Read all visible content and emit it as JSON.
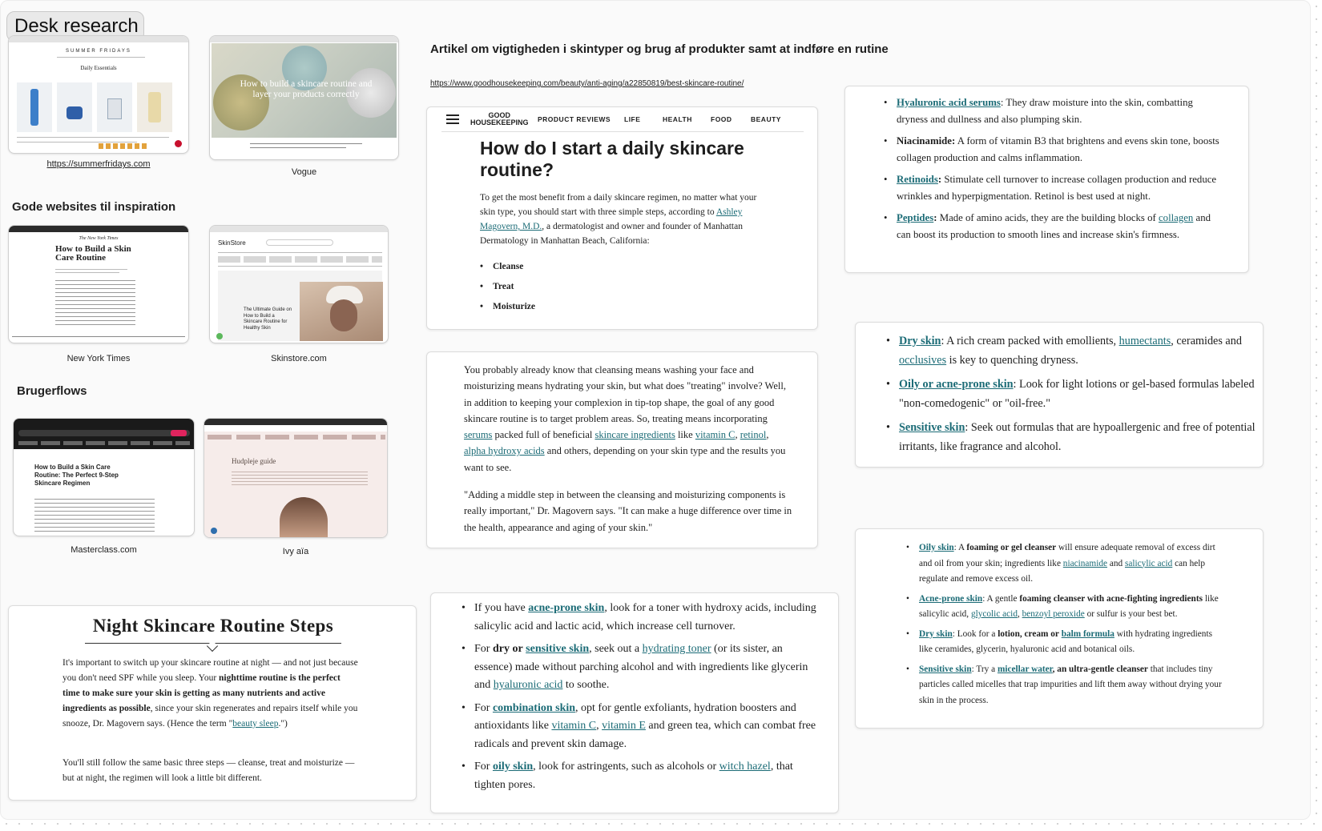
{
  "board": {
    "title": "Desk research",
    "section_inspiration": "Gode websites til inspiration",
    "section_userflows": "Brugerflows",
    "article_heading": "Artikel om vigtigheden i skintyper og brug af produkter samt at indføre en rutine",
    "article_url": "https://www.goodhousekeeping.com/beauty/anti-aging/a22850819/best-skincare-routine/"
  },
  "thumbnails": {
    "summerfridays": {
      "caption": "https://summerfridays.com",
      "brand": "SUMMER FRIDAYS",
      "heading": "Daily Essentials"
    },
    "vogue": {
      "caption": "Vogue",
      "hero_text": "How to build a skincare routine and layer your products correctly"
    },
    "nyt": {
      "caption": "New York Times",
      "masthead": "The New York Times",
      "headline": "How to Build a Skin Care Routine"
    },
    "skinstore": {
      "caption": "Skinstore.com",
      "logo": "SkinStore",
      "headline": "The Ultimate Guide on How to Build a Skincare Routine for Healthy Skin"
    },
    "masterclass": {
      "caption": "Masterclass.com",
      "headline": "How to Build a Skin Care Routine: The Perfect 9-Step Skincare Regimen"
    },
    "ivy": {
      "caption": "Ivy aïa",
      "heading": "Hudpleje guide"
    }
  },
  "gh_nav": {
    "logo_top": "GOOD",
    "logo_bottom": "HOUSEKEEPING",
    "items": [
      "PRODUCT REVIEWS",
      "LIFE",
      "HEALTH",
      "FOOD",
      "BEAUTY"
    ]
  },
  "gh_article": {
    "title": "How do I start a daily skincare routine?",
    "intro_1": "To get the most benefit from a daily skincare regimen, no matter what your skin type, you should start with three simple steps, according to",
    "intro_link": "Ashley Magovern, M.D.",
    "intro_2": ", a dermatologist and owner and founder of Manhattan Dermatology in Manhattan Beach, California:",
    "steps": [
      "Cleanse",
      "Treat",
      "Moisturize"
    ]
  },
  "cleansing": {
    "p1_a": "You probably already know that cleansing means washing your face and moisturizing means hydrating your skin, but what does \"treating\" involve? Well, in addition to keeping your complexion in tip-top shape, the goal of any good skincare routine is to target problem areas. So, treating means incorporating",
    "l_serums": "serums",
    "p1_b": "packed full of beneficial",
    "l_ingredients": "skincare ingredients",
    "p1_c": "like",
    "l_vitc": "vitamin C",
    "l_retinol": "retinol",
    "l_aha": "alpha hydroxy acids",
    "p1_d": "and others, depending on your skin type and the results you want to see.",
    "p2": "\"Adding a middle step in between the cleansing and moisturizing components is really important,\" Dr. Magovern says. \"It can make a huge difference over time in the health, appearance and aging of your skin.\""
  },
  "ingredients": {
    "hyaluronic_label": "Hyaluronic acid serums",
    "hyaluronic_text": ": They draw moisture into the skin, combatting dryness and dullness and also plumping skin.",
    "niacinamide_label": "Niacinamide:",
    "niacinamide_text": "A form of vitamin B3 that brightens and evens skin tone, boosts collagen production and calms inflammation.",
    "retinoids_label": "Retinoids",
    "retinoids_text": "Stimulate cell turnover to increase collagen production and reduce wrinkles and hyperpigmentation. Retinol is best used at night.",
    "peptides_label": "Peptides",
    "peptides_text_a": "Made of amino acids, they are the building blocks of",
    "peptides_link": "collagen",
    "peptides_text_b": "and can boost its production to smooth lines and increase skin's firmness."
  },
  "skintypes": {
    "dry_label": "Dry skin",
    "dry_a": ": A rich cream packed with emollients,",
    "dry_l1": "humectants",
    "dry_b": ", ceramides and",
    "dry_l2": "occlusives",
    "dry_c": "is key to quenching dryness.",
    "oily_label": "Oily or acne-prone skin",
    "oily_text": ": Look for light lotions or gel-based formulas labeled \"non-comedogenic\" or \"oil-free.\"",
    "sensitive_label": "Sensitive skin",
    "sensitive_text": ": Seek out formulas that are hypoallergenic and free of potential irritants, like fragrance and alcohol."
  },
  "cleansers": {
    "oily_label": "Oily skin",
    "oily_a": ": A",
    "oily_b": "foaming or gel cleanser",
    "oily_c": "will ensure adequate removal of excess dirt and oil from your skin; ingredients like",
    "oily_l1": "niacinamide",
    "oily_d": "and",
    "oily_l2": "salicylic acid",
    "oily_e": "can help regulate and remove excess oil.",
    "acne_label": "Acne-prone skin",
    "acne_a": ": A gentle",
    "acne_b": "foaming cleanser with acne-fighting ingredients",
    "acne_c": "like salicylic acid,",
    "acne_l1": "glycolic acid",
    "acne_l2": "benzoyl peroxide",
    "acne_d": "or sulfur is your best bet.",
    "dry_label": "Dry skin",
    "dry_a": ": Look for a",
    "dry_b": "lotion, cream or",
    "dry_l": "balm formula",
    "dry_c": "with hydrating ingredients like ceramides, glycerin, hyaluronic acid and botanical oils.",
    "sens_label": "Sensitive skin",
    "sens_a": ": Try a",
    "sens_l": "micellar water",
    "sens_b": ", an ultra-gentle cleanser",
    "sens_c": "that includes tiny particles called micelles that trap impurities and lift them away without drying your skin in the process."
  },
  "toners": {
    "t1_a": "If you have",
    "t1_l": "acne-prone skin",
    "t1_b": ", look for a toner with hydroxy acids, including salicylic acid and lactic acid, which increase cell turnover.",
    "t2_a": "For",
    "t2_b": "dry or",
    "t2_l1": "sensitive skin",
    "t2_c": ", seek out a",
    "t2_l2": "hydrating toner",
    "t2_d": "(or its sister, an essence) made without parching alcohol and with ingredients like glycerin and",
    "t2_l3": "hyaluronic acid",
    "t2_e": "to soothe.",
    "t3_a": "For",
    "t3_l1": "combination skin",
    "t3_b": ", opt for gentle exfoliants, hydration boosters and antioxidants like",
    "t3_l2": "vitamin C",
    "t3_l3": "vitamin E",
    "t3_c": "and green tea, which can combat free radicals and prevent skin damage.",
    "t4_a": "For",
    "t4_l1": "oily skin",
    "t4_b": ", look for astringents, such as alcohols or",
    "t4_l2": "witch hazel",
    "t4_c": ", that tighten pores."
  },
  "night": {
    "title": "Night Skincare Routine Steps",
    "p1_a": "It's important to switch up your skincare routine at night — and not just because you don't need SPF while you sleep. Your",
    "p1_b": "nighttime routine is the perfect time to make sure your skin is getting as many nutrients and active ingredients as possible",
    "p1_c": ", since your skin regenerates and repairs itself while you snooze, Dr. Magovern says. (Hence the term \"",
    "p1_l": "beauty sleep",
    "p1_d": ".\")",
    "p2": "You'll still follow the same basic three steps — cleanse, treat and moisturize — but at night, the regimen will look a little bit different."
  }
}
